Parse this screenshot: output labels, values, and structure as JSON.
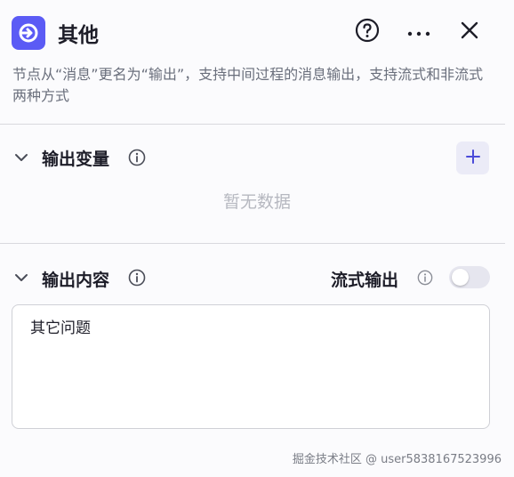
{
  "header": {
    "title": "其他",
    "icon": "arrow-right-circle-icon",
    "accent_color": "#5b5bf5",
    "actions": [
      "help-icon",
      "more-icon",
      "close-icon"
    ]
  },
  "description": "节点从“消息”更名为“输出”，支持中间过程的消息输出，支持流式和非流式两种方式",
  "output_variables": {
    "title": "输出变量",
    "empty_text": "暂无数据"
  },
  "output_content": {
    "title": "输出内容",
    "stream_label": "流式输出",
    "stream_enabled": false,
    "value": "其它问题"
  },
  "watermark": "掘金技术社区 @ user5838167523996"
}
